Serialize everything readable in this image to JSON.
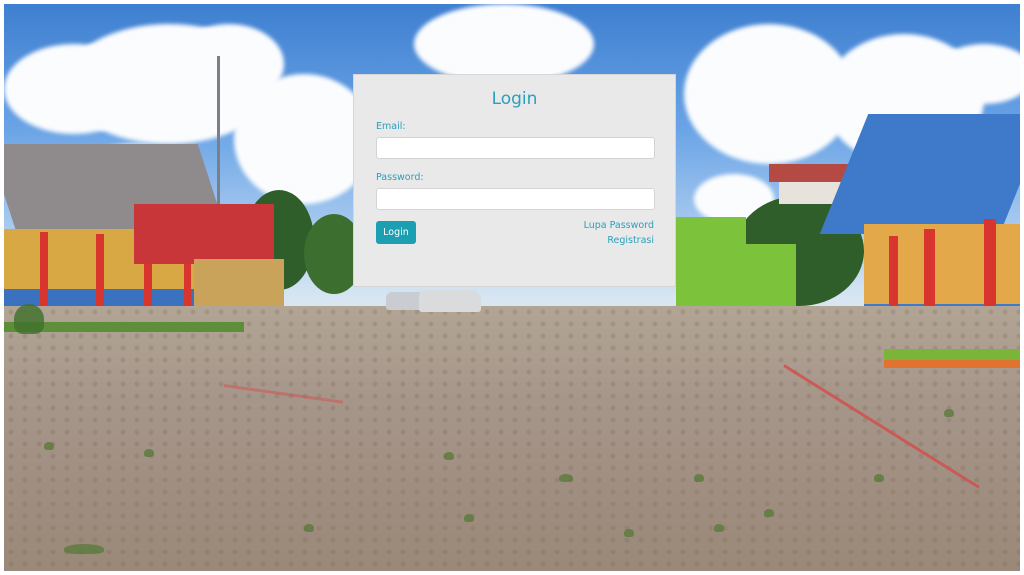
{
  "login": {
    "title": "Login",
    "email_label": "Email:",
    "email_value": "",
    "password_label": "Password:",
    "password_value": "",
    "login_button": "Login",
    "forgot_password_link": "Lupa Password",
    "register_link": "Registrasi"
  },
  "colors": {
    "accent": "#2a9fbb",
    "button": "#1d9fb2",
    "panel": "#e9e9e9"
  }
}
